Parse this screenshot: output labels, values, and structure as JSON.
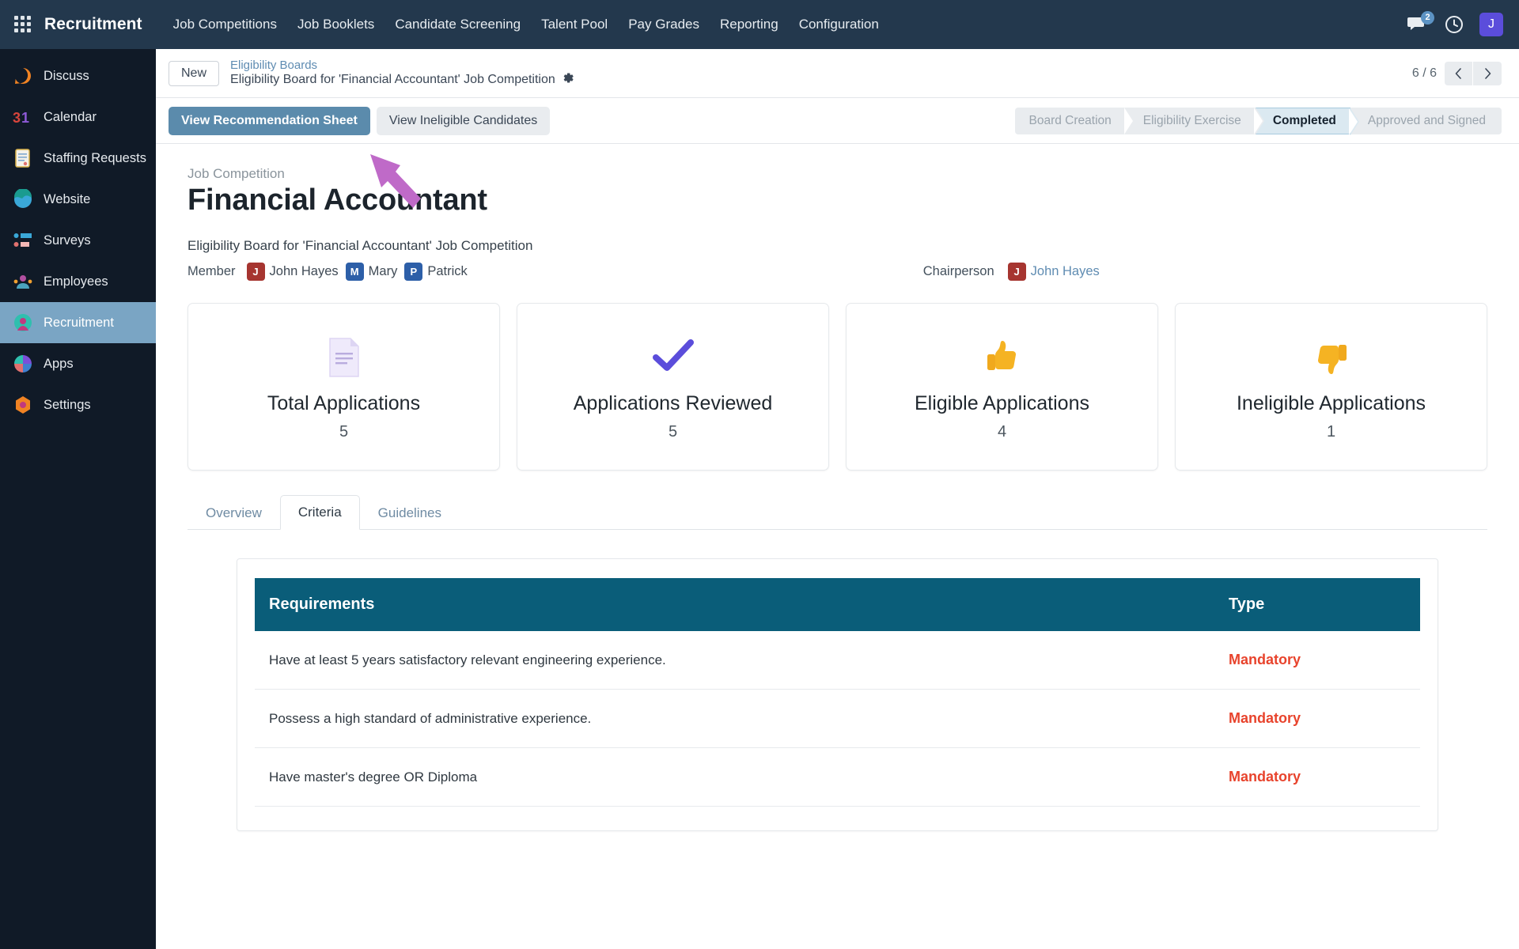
{
  "navbar": {
    "brand": "Recruitment",
    "apps_icon": "apps-grid-icon",
    "menu": [
      {
        "label": "Job Competitions"
      },
      {
        "label": "Job Booklets"
      },
      {
        "label": "Candidate Screening"
      },
      {
        "label": "Talent Pool"
      },
      {
        "label": "Pay Grades"
      },
      {
        "label": "Reporting"
      },
      {
        "label": "Configuration"
      }
    ],
    "messages_icon": "messages-icon",
    "messages_badge": "2",
    "activity_icon": "clock-icon",
    "avatar_initial": "J"
  },
  "sidebar": {
    "items": [
      {
        "label": "Discuss",
        "icon": "discuss-icon"
      },
      {
        "label": "Calendar",
        "icon": "calendar-icon"
      },
      {
        "label": "Staffing Requests",
        "icon": "staffing-requests-icon"
      },
      {
        "label": "Website",
        "icon": "website-icon"
      },
      {
        "label": "Surveys",
        "icon": "surveys-icon"
      },
      {
        "label": "Employees",
        "icon": "employees-icon"
      },
      {
        "label": "Recruitment",
        "icon": "recruitment-icon"
      },
      {
        "label": "Apps",
        "icon": "apps-icon"
      },
      {
        "label": "Settings",
        "icon": "settings-icon"
      }
    ],
    "active": "Recruitment"
  },
  "control_panel": {
    "new_label": "New",
    "breadcrumb_root": "Eligibility Boards",
    "breadcrumb_current": "Eligibility Board for 'Financial Accountant' Job Competition",
    "gear_icon": "gear-icon",
    "pager_count": "6 / 6",
    "prev_icon": "chevron-left-icon",
    "next_icon": "chevron-right-icon"
  },
  "actions": {
    "primary_label": "View Recommendation Sheet",
    "secondary_label": "View Ineligible Candidates"
  },
  "statusbar": {
    "stages": [
      {
        "label": "Board Creation",
        "active": false
      },
      {
        "label": "Eligibility Exercise",
        "active": false
      },
      {
        "label": "Completed",
        "active": true
      },
      {
        "label": "Approved and Signed",
        "active": false
      }
    ]
  },
  "record": {
    "sub_label": "Job Competition",
    "title": "Financial Accountant",
    "description": "Eligibility Board for 'Financial Accountant' Job Competition",
    "member_label": "Member",
    "members": [
      {
        "initial": "J",
        "name": "John Hayes",
        "color": "#a63530"
      },
      {
        "initial": "M",
        "name": "Mary",
        "color": "#2d5fa8"
      },
      {
        "initial": "P",
        "name": "Patrick",
        "color": "#2d5fa8"
      }
    ],
    "chairperson_label": "Chairperson",
    "chairperson": {
      "initial": "J",
      "name": "John Hayes",
      "color": "#a63530"
    }
  },
  "stat_cards": [
    {
      "icon": "document-icon",
      "glyph": "📄",
      "title": "Total Applications",
      "value": "5"
    },
    {
      "icon": "check-icon",
      "glyph": "✔",
      "title": "Applications Reviewed",
      "value": "5"
    },
    {
      "icon": "thumbs-up-icon",
      "glyph": "👍",
      "title": "Eligible Applications",
      "value": "4"
    },
    {
      "icon": "thumbs-down-icon",
      "glyph": "👎",
      "title": "Ineligible Applications",
      "value": "1"
    }
  ],
  "tabs": [
    {
      "label": "Overview",
      "active": false
    },
    {
      "label": "Criteria",
      "active": true
    },
    {
      "label": "Guidelines",
      "active": false
    }
  ],
  "criteria_table": {
    "headers": {
      "requirements": "Requirements",
      "type": "Type"
    },
    "rows": [
      {
        "requirement": "Have at least 5 years satisfactory relevant engineering experience.",
        "type": "Mandatory"
      },
      {
        "requirement": "Possess a high standard of administrative experience.",
        "type": "Mandatory"
      },
      {
        "requirement": "Have master's degree OR Diploma",
        "type": "Mandatory"
      }
    ]
  },
  "annotation": {
    "arrow_icon": "annotation-arrow-icon",
    "color": "#bf6ac8"
  },
  "colors": {
    "navbar_bg": "#23384d",
    "sidebar_bg": "#101a27",
    "sidebar_active": "#7aa5c4",
    "primary_button": "#5b8bac",
    "table_header": "#0a5d79",
    "mandatory": "#e8432c",
    "link": "#5f8cb2"
  }
}
